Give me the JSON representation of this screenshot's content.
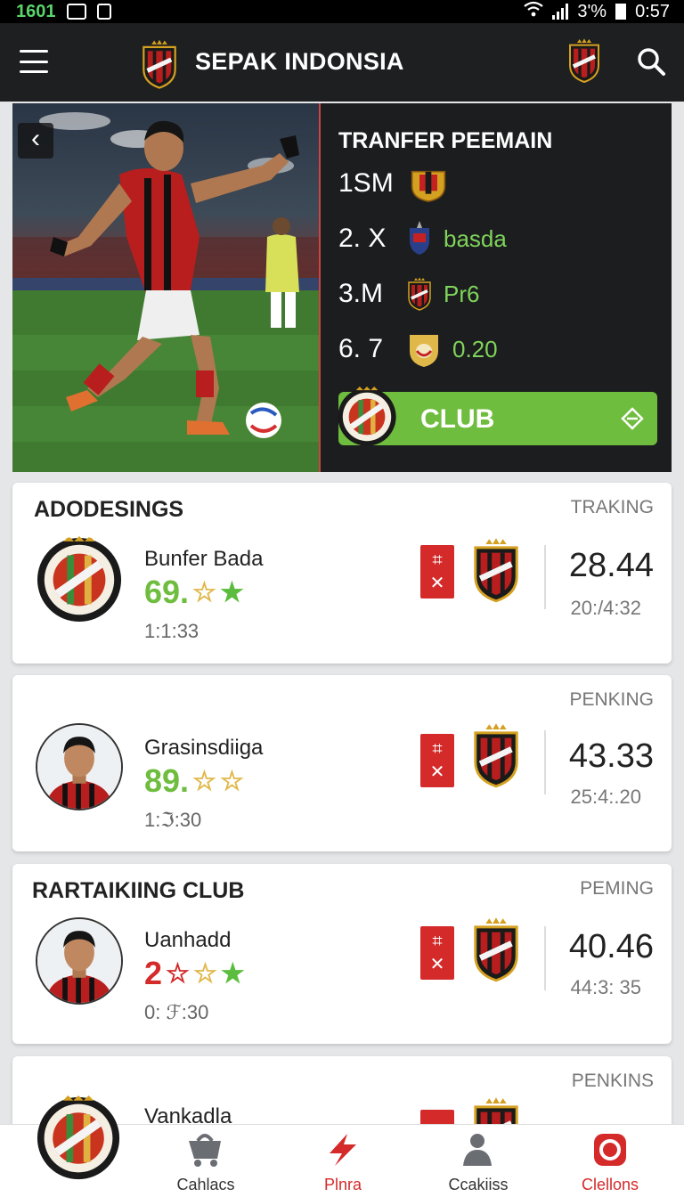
{
  "status": {
    "time_left": "1601",
    "battery": "3'%",
    "clock": "0:57"
  },
  "header": {
    "title": "SEPAK INDONSIA"
  },
  "hero": {
    "title": "TRANFER PEEMAIN",
    "stats": [
      {
        "num": "1SM",
        "text": ""
      },
      {
        "num": "2. X",
        "text": "basda"
      },
      {
        "num": "3.M",
        "text": "Pr6"
      },
      {
        "num": "6. 7",
        "text": "0.20"
      }
    ],
    "club_button": "CLUB"
  },
  "cards": [
    {
      "title": "ADODESINGS",
      "tag": "TRAKING",
      "name": "Bunfer Bada",
      "rating": "69.",
      "time": "1:1:33",
      "score": "28.44",
      "subscore": "20:/4:32"
    },
    {
      "title": "",
      "tag": "PENKING",
      "name": "Grasinsdiiga",
      "rating": "89.",
      "time": "1:ℑ:30",
      "score": "43.33",
      "subscore": "25:4:.20"
    },
    {
      "title": "RARTAIKIING CLUB",
      "tag": "PEMING",
      "name": "Uanhadd",
      "rating": "2",
      "time": "0: ℱ:30",
      "score": "40.46",
      "subscore": "44:3: 35"
    },
    {
      "title": "",
      "tag": "PENKINS",
      "name": "Vankadla",
      "rating": "",
      "time": "",
      "score": "",
      "subscore": ""
    }
  ],
  "tag_glyphs": {
    "top": "⌗",
    "bottom": "✕"
  },
  "nav": [
    {
      "label": "Cahlacs",
      "icon": "cart-icon"
    },
    {
      "label": "Plnra",
      "icon": "lightning-icon"
    },
    {
      "label": "Ccakiiss",
      "icon": "people-icon"
    },
    {
      "label": "Clellons",
      "icon": "record-icon"
    }
  ],
  "colors": {
    "accent_green": "#6fbd3e",
    "accent_red": "#d42a2a",
    "dark": "#1e1f21"
  }
}
